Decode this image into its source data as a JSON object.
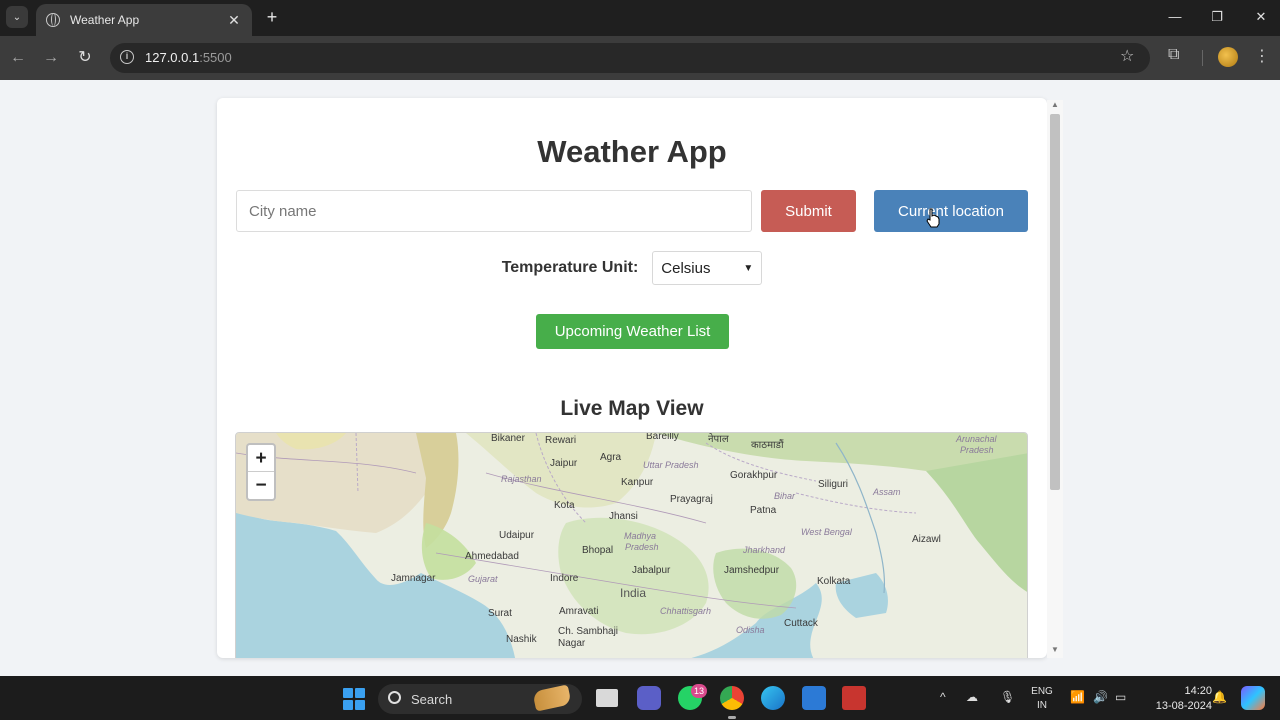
{
  "browser": {
    "tab_title": "Weather App",
    "tab_close": "✕",
    "new_tab": "+",
    "url_host": "127.0.0.1",
    "url_port": ":5500",
    "win_minimize": "—",
    "win_restore": "❐",
    "win_close": "✕"
  },
  "app": {
    "title": "Weather App",
    "city_placeholder": "City name",
    "submit_label": "Submit",
    "location_label": "Current location",
    "unit_label": "Temperature Unit:",
    "unit_selected": "Celsius",
    "upcoming_label": "Upcoming Weather List",
    "map_title": "Live Map View"
  },
  "map": {
    "zoom_in": "+",
    "zoom_out": "−",
    "labels": {
      "bikaner": "Bikaner",
      "rewari": "Rewari",
      "bareilly": "Bareilly",
      "nepal_script": "नेपाल",
      "kathmandu_script": "काठमाडौं",
      "arunachal": "Arunachal",
      "pradesh_ap": "Pradesh",
      "jaipur": "Jaipur",
      "agra": "Agra",
      "uttar_pradesh": "Uttar Pradesh",
      "gorakhpur": "Gorakhpur",
      "rajasthan": "Rajasthan",
      "kanpur": "Kanpur",
      "siliguri": "Siliguri",
      "assam": "Assam",
      "kota": "Kota",
      "prayagraj": "Prayagraj",
      "bihar": "Bihar",
      "jhansi": "Jhansi",
      "patna": "Patna",
      "madhya": "Madhya",
      "pradesh_mp": "Pradesh",
      "udaipur": "Udaipur",
      "aizawl": "Aizawl",
      "ahmedabad": "Ahmedabad",
      "bhopal": "Bhopal",
      "west_bengal": "West Bengal",
      "jharkhand": "Jharkhand",
      "jamnagar": "Jamnagar",
      "gujarat": "Gujarat",
      "indore": "Indore",
      "jabalpur": "Jabalpur",
      "jamshedpur": "Jamshedpur",
      "kolkata": "Kolkata",
      "india": "India",
      "amravati": "Amravati",
      "chhattisgarh": "Chhattisgarh",
      "surat": "Surat",
      "cuttack": "Cuttack",
      "odisha": "Odisha",
      "nashik": "Nashik",
      "ch_sambhaji": "Ch. Sambhaji",
      "nagar": "Nagar"
    }
  },
  "taskbar": {
    "search": "Search",
    "whatsapp_badge": "13",
    "lang_top": "ENG",
    "lang_bottom": "IN",
    "time": "14:20",
    "date": "13-08-2024"
  },
  "colors": {
    "submit": "#c65c55",
    "location": "#4a82b9",
    "upcoming": "#47ae4a"
  }
}
